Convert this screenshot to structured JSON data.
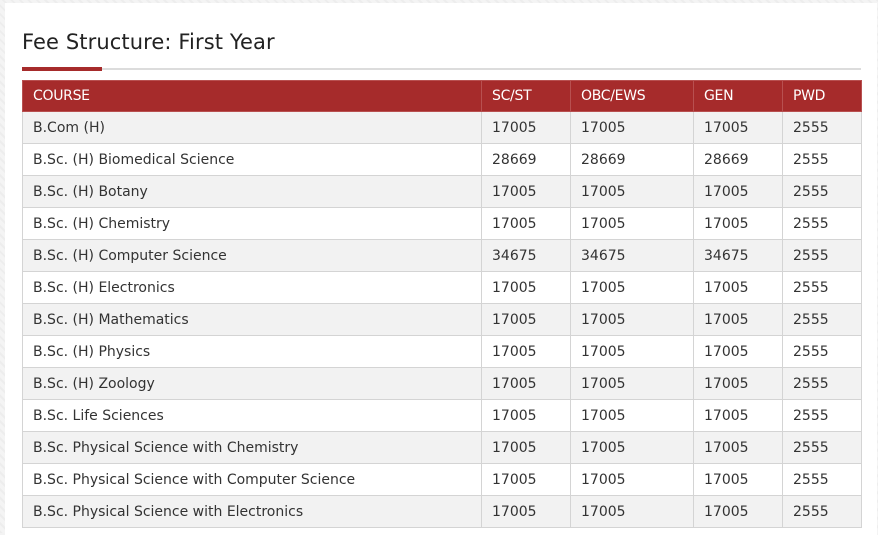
{
  "heading": "Fee Structure: First Year",
  "table": {
    "columns": [
      "COURSE",
      "SC/ST",
      "OBC/EWS",
      "GEN",
      "PWD"
    ],
    "rows": [
      [
        "B.Com (H)",
        "17005",
        "17005",
        "17005",
        "2555"
      ],
      [
        "B.Sc. (H) Biomedical Science",
        "28669",
        "28669",
        "28669",
        "2555"
      ],
      [
        "B.Sc. (H) Botany",
        "17005",
        "17005",
        "17005",
        "2555"
      ],
      [
        "B.Sc. (H) Chemistry",
        "17005",
        "17005",
        "17005",
        "2555"
      ],
      [
        "B.Sc. (H) Computer Science",
        "34675",
        "34675",
        "34675",
        "2555"
      ],
      [
        "B.Sc. (H) Electronics",
        "17005",
        "17005",
        "17005",
        "2555"
      ],
      [
        "B.Sc. (H) Mathematics",
        "17005",
        "17005",
        "17005",
        "2555"
      ],
      [
        "B.Sc. (H) Physics",
        "17005",
        "17005",
        "17005",
        "2555"
      ],
      [
        "B.Sc. (H) Zoology",
        "17005",
        "17005",
        "17005",
        "2555"
      ],
      [
        "B.Sc. Life Sciences",
        "17005",
        "17005",
        "17005",
        "2555"
      ],
      [
        "B.Sc. Physical Science with Chemistry",
        "17005",
        "17005",
        "17005",
        "2555"
      ],
      [
        "B.Sc. Physical Science with Computer Science",
        "17005",
        "17005",
        "17005",
        "2555"
      ],
      [
        "B.Sc. Physical Science with Electronics",
        "17005",
        "17005",
        "17005",
        "2555"
      ]
    ]
  },
  "colors": {
    "accent": "#a62b2b",
    "header_text": "#ffffff",
    "row_stripe": "#f2f2f2",
    "border": "#d4d4d4"
  }
}
